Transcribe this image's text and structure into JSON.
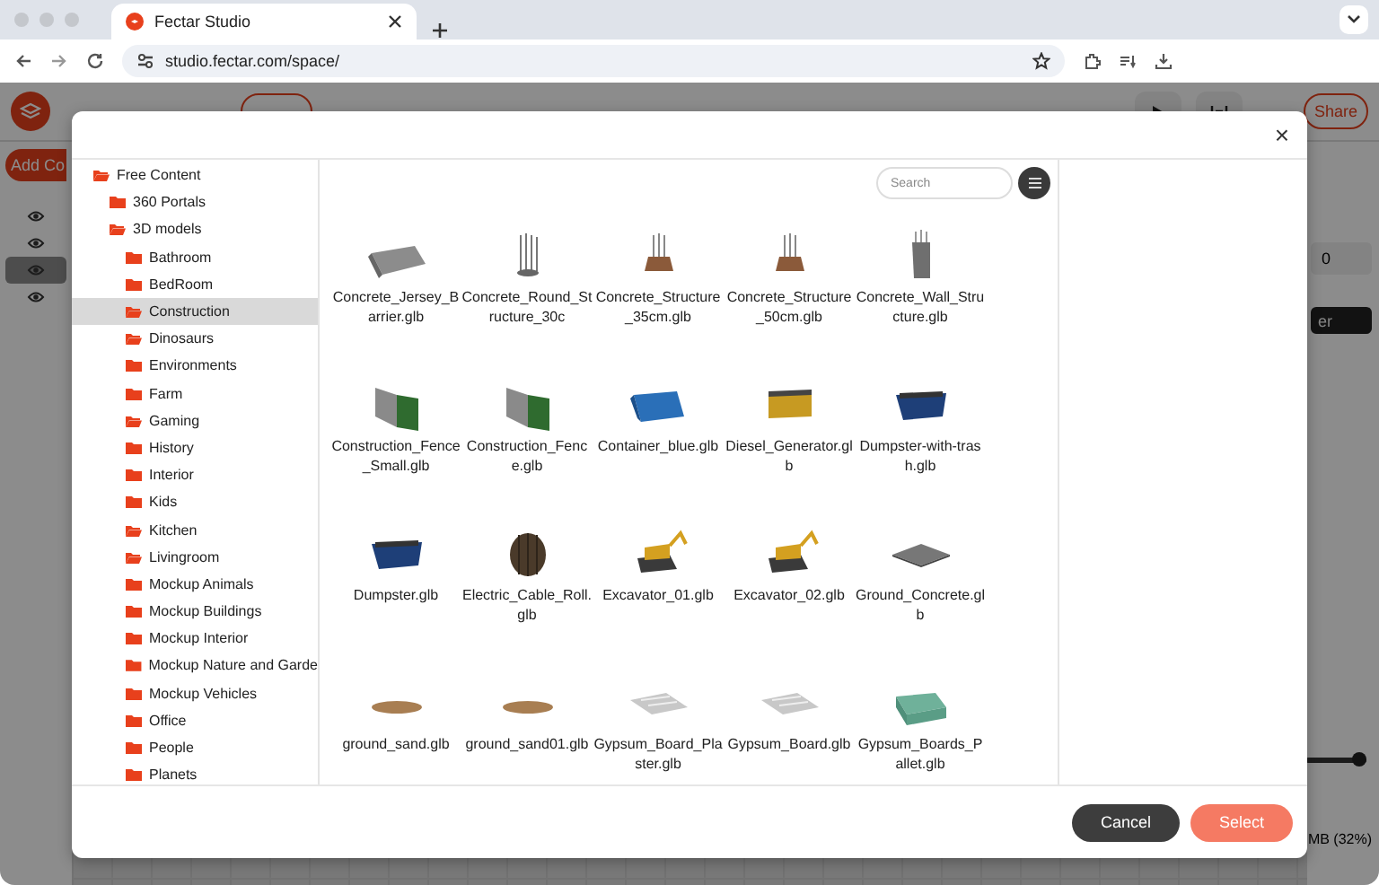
{
  "browser": {
    "tab_title": "Fectar Studio",
    "url": "studio.fectar.com/space/"
  },
  "app": {
    "add_label": "Add Co",
    "share_label": "Share",
    "field_value": "0",
    "button_fragment": "er",
    "usage_fragment": "MB (32%)",
    "layers": [
      {
        "selected": false
      },
      {
        "selected": false
      },
      {
        "selected": true
      },
      {
        "selected": false
      }
    ]
  },
  "dialog": {
    "close": "×",
    "tree": [
      {
        "label": "Free Content",
        "kind": "open",
        "selected": false,
        "children": [
          {
            "label": "360 Portals",
            "kind": "closed",
            "selected": false
          },
          {
            "label": "3D models",
            "kind": "open",
            "selected": false,
            "children": [
              {
                "label": "Bathroom",
                "kind": "closed",
                "selected": false
              },
              {
                "label": "BedRoom",
                "kind": "closed",
                "selected": false
              },
              {
                "label": "Construction",
                "kind": "open",
                "selected": true
              },
              {
                "label": "Dinosaurs",
                "kind": "open",
                "selected": false
              },
              {
                "label": "Environments",
                "kind": "closed",
                "selected": false
              },
              {
                "label": "Farm",
                "kind": "closed",
                "selected": false
              },
              {
                "label": "Gaming",
                "kind": "open",
                "selected": false
              },
              {
                "label": "History",
                "kind": "closed",
                "selected": false
              },
              {
                "label": "Interior",
                "kind": "closed",
                "selected": false
              },
              {
                "label": "Kids",
                "kind": "closed",
                "selected": false
              },
              {
                "label": "Kitchen",
                "kind": "open",
                "selected": false
              },
              {
                "label": "Livingroom",
                "kind": "open",
                "selected": false
              },
              {
                "label": "Mockup Animals",
                "kind": "closed",
                "selected": false
              },
              {
                "label": "Mockup Buildings",
                "kind": "closed",
                "selected": false
              },
              {
                "label": "Mockup Interior",
                "kind": "closed",
                "selected": false
              },
              {
                "label": "Mockup Nature and Garde",
                "kind": "closed",
                "selected": false
              },
              {
                "label": "Mockup Vehicles",
                "kind": "closed",
                "selected": false
              },
              {
                "label": "Office",
                "kind": "closed",
                "selected": false
              },
              {
                "label": "People",
                "kind": "closed",
                "selected": false
              },
              {
                "label": "Planets",
                "kind": "closed",
                "selected": false
              }
            ]
          }
        ]
      }
    ],
    "search": {
      "placeholder": "Search"
    },
    "assets": [
      {
        "name": "Concrete_Jersey_Barrier.glb",
        "kind": "barrier"
      },
      {
        "name": "Concrete_Round_Structure_30c",
        "kind": "pillar"
      },
      {
        "name": "Concrete_Structure_35cm.glb",
        "kind": "footing"
      },
      {
        "name": "Concrete_Structure_50cm.glb",
        "kind": "footing"
      },
      {
        "name": "Concrete_Wall_Structure.glb",
        "kind": "wall"
      },
      {
        "name": "Construction_Fence_Small.glb",
        "kind": "fence"
      },
      {
        "name": "Construction_Fence.glb",
        "kind": "fence"
      },
      {
        "name": "Container_blue.glb",
        "kind": "container"
      },
      {
        "name": "Diesel_Generator.glb",
        "kind": "generator"
      },
      {
        "name": "Dumpster-with-trash.glb",
        "kind": "dumpster"
      },
      {
        "name": "Dumpster.glb",
        "kind": "dumpster"
      },
      {
        "name": "Electric_Cable_Roll.glb",
        "kind": "reel"
      },
      {
        "name": "Excavator_01.glb",
        "kind": "excavator"
      },
      {
        "name": "Excavator_02.glb",
        "kind": "excavator"
      },
      {
        "name": "Ground_Concrete.glb",
        "kind": "slab"
      },
      {
        "name": "ground_sand.glb",
        "kind": "disc"
      },
      {
        "name": "ground_sand01.glb",
        "kind": "disc"
      },
      {
        "name": "Gypsum_Board_Plaster.glb",
        "kind": "board"
      },
      {
        "name": "Gypsum_Board.glb",
        "kind": "board"
      },
      {
        "name": "Gypsum_Boards_Pallet.glb",
        "kind": "pallet"
      }
    ],
    "buttons": [
      {
        "label": "Cancel",
        "kind": "secondary"
      },
      {
        "label": "Select",
        "kind": "primary"
      }
    ]
  }
}
